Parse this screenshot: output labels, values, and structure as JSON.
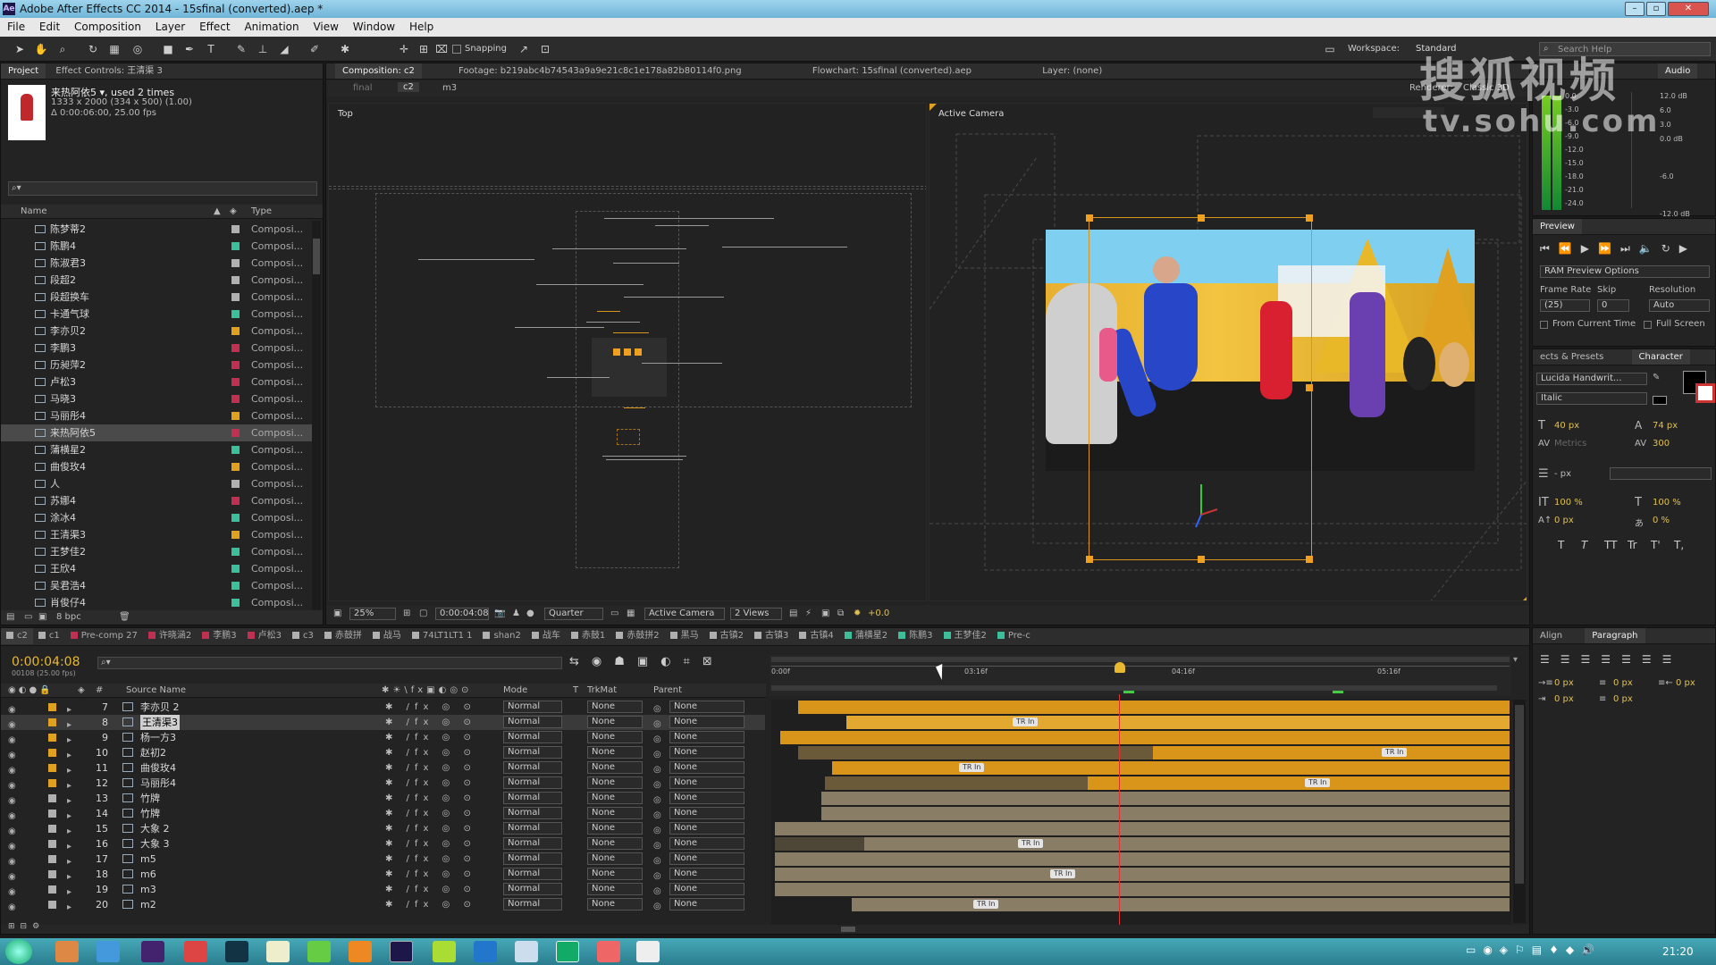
{
  "window": {
    "title": "Adobe After Effects CC 2014 - 15sfinal (converted).aep *"
  },
  "menu": [
    "File",
    "Edit",
    "Composition",
    "Layer",
    "Effect",
    "Animation",
    "View",
    "Window",
    "Help"
  ],
  "toolbar": {
    "snapping": "Snapping",
    "workspace_label": "Workspace:",
    "workspace_value": "Standard",
    "search": "Search Help"
  },
  "project": {
    "tabs": [
      "Project",
      "Effect Controls: 王清渠 3"
    ],
    "item_name": "来热阿依5",
    "used": ", used 2 times",
    "dims": "1333 x 2000  (334 x 500) (1.00)",
    "duration": "Δ 0:00:06:00, 25.00 fps",
    "search_placeholder": "",
    "col_name": "Name",
    "col_type": "Type",
    "items": [
      {
        "name": "陈梦蒂2",
        "type": "Composi...",
        "color": "#b0b0b0"
      },
      {
        "name": "陈鹏4",
        "type": "Composi...",
        "color": "#3cbf9a"
      },
      {
        "name": "陈淑君3",
        "type": "Composi...",
        "color": "#b0b0b0"
      },
      {
        "name": "段超2",
        "type": "Composi...",
        "color": "#b0b0b0"
      },
      {
        "name": "段超换车",
        "type": "Composi...",
        "color": "#b0b0b0"
      },
      {
        "name": "卡通气球",
        "type": "Composi...",
        "color": "#3cbf9a"
      },
      {
        "name": "李亦贝2",
        "type": "Composi...",
        "color": "#e0a020"
      },
      {
        "name": "李鹏3",
        "type": "Composi...",
        "color": "#c03050"
      },
      {
        "name": "历昶萍2",
        "type": "Composi...",
        "color": "#c03050"
      },
      {
        "name": "卢松3",
        "type": "Composi...",
        "color": "#c03050"
      },
      {
        "name": "马晓3",
        "type": "Composi...",
        "color": "#c03050"
      },
      {
        "name": "马丽彤4",
        "type": "Composi...",
        "color": "#e0a020"
      },
      {
        "name": "来热阿依5",
        "type": "Composi...",
        "color": "#c03050"
      },
      {
        "name": "蒲横星2",
        "type": "Composi...",
        "color": "#3cbf9a"
      },
      {
        "name": "曲俊玫4",
        "type": "Composi...",
        "color": "#e0a020"
      },
      {
        "name": "人",
        "type": "Composi...",
        "color": "#b0b0b0"
      },
      {
        "name": "苏娜4",
        "type": "Composi...",
        "color": "#c03050"
      },
      {
        "name": "涂冰4",
        "type": "Composi...",
        "color": "#3cbf9a"
      },
      {
        "name": "王清渠3",
        "type": "Composi...",
        "color": "#e0a020"
      },
      {
        "name": "王梦佳2",
        "type": "Composi...",
        "color": "#3cbf9a"
      },
      {
        "name": "王欣4",
        "type": "Composi...",
        "color": "#3cbf9a"
      },
      {
        "name": "吴君浩4",
        "type": "Composi...",
        "color": "#3cbf9a"
      },
      {
        "name": "肖俊仔4",
        "type": "Composi...",
        "color": "#3cbf9a"
      }
    ],
    "bpc": "8 bpc"
  },
  "viewer": {
    "tabs": [
      "Composition: c2",
      "Footage: b219abc4b74543a9a9e21c8c1e178a82b80114f0.png",
      "Flowchart: 15sfinal (converted).aep",
      "Layer: (none)"
    ],
    "crumbs": [
      "final",
      "c2",
      "m3"
    ],
    "renderer": "Renderer:",
    "renderer_value": "Classic 3D",
    "top_label": "Top",
    "active_label": "Active Camera",
    "zoom": "25%",
    "timecode": "0:00:04:08",
    "resolution": "Quarter",
    "camera": "Active Camera",
    "views": "2 Views",
    "exposure": "+0.0"
  },
  "audio": {
    "tab": "Audio",
    "left": [
      "0.0",
      "-3.0",
      "-6.0",
      "-9.0",
      "-12.0",
      "-15.0",
      "-18.0",
      "-21.0",
      "-24.0"
    ],
    "right": [
      "12.0 dB",
      "6.0",
      "3.0",
      "0.0 dB",
      "-6.0",
      "-12.0 dB"
    ]
  },
  "preview": {
    "tab": "Preview",
    "ram": "RAM Preview Options",
    "frame_rate": "Frame Rate",
    "skip": "Skip",
    "resolution": "Resolution",
    "fr_val": "(25)",
    "skip_val": "0",
    "res_val": "Auto",
    "from_current": "From Current Time",
    "full_screen": "Full Screen"
  },
  "character": {
    "tabs": [
      "ects & Presets",
      "Character"
    ],
    "font": "Lucida Handwrit...",
    "style": "Italic",
    "size": "40 px",
    "leading": "74 px",
    "kerning": "Metrics",
    "tracking": "300",
    "stroke": "- px",
    "vscale": "100 %",
    "hscale": "100 %",
    "baseline": "0 px",
    "tsume": "0 %",
    "fmt": [
      "T",
      "T",
      "TT",
      "Tr",
      "T'",
      "T,"
    ]
  },
  "paragraph": {
    "tabs": [
      "Align",
      "Paragraph"
    ],
    "indents": [
      "0 px",
      "0 px",
      "0 px",
      "0 px",
      "0 px"
    ]
  },
  "timeline": {
    "tabs": [
      {
        "name": "c2",
        "color": "#b0b0b0"
      },
      {
        "name": "c1",
        "color": "#b0b0b0"
      },
      {
        "name": "Pre-comp 27",
        "color": "#c03050"
      },
      {
        "name": "许晓涵2",
        "color": "#c03050"
      },
      {
        "name": "李鹏3",
        "color": "#c03050"
      },
      {
        "name": "卢松3",
        "color": "#c03050"
      },
      {
        "name": "c3",
        "color": "#b0b0b0"
      },
      {
        "name": "赤鼓拼",
        "color": "#b0b0b0"
      },
      {
        "name": "战马",
        "color": "#b0b0b0"
      },
      {
        "name": "74LT1LT1 1",
        "color": "#b0b0b0"
      },
      {
        "name": "shan2",
        "color": "#b0b0b0"
      },
      {
        "name": "战车",
        "color": "#b0b0b0"
      },
      {
        "name": "赤鼓1",
        "color": "#b0b0b0"
      },
      {
        "name": "赤鼓拼2",
        "color": "#b0b0b0"
      },
      {
        "name": "黑马",
        "color": "#b0b0b0"
      },
      {
        "name": "古镇2",
        "color": "#b0b0b0"
      },
      {
        "name": "古镇3",
        "color": "#b0b0b0"
      },
      {
        "name": "古镇4",
        "color": "#b0b0b0"
      },
      {
        "name": "蒲横星2",
        "color": "#3cbf9a"
      },
      {
        "name": "陈鹏3",
        "color": "#3cbf9a"
      },
      {
        "name": "王梦佳2",
        "color": "#3cbf9a"
      },
      {
        "name": "Pre-c",
        "color": "#3cbf9a"
      }
    ],
    "timecode": "0:00:04:08",
    "frames": "00108 (25.00 fps)",
    "headers": {
      "source": "Source Name",
      "mode": "Mode",
      "t": "T",
      "trkmat": "TrkMat",
      "parent": "Parent"
    },
    "ruler": [
      "0:00f",
      "03:16f",
      "04:16f",
      "05:16f"
    ],
    "layers": [
      {
        "num": "7",
        "name": "李亦贝 2",
        "color": "#e0a020",
        "mode": "Normal",
        "trk": "None",
        "parent": "None"
      },
      {
        "num": "8",
        "name": "王清渠3",
        "color": "#e0a020",
        "mode": "Normal",
        "trk": "None",
        "parent": "None"
      },
      {
        "num": "9",
        "name": "杨一方3",
        "color": "#e0a020",
        "mode": "Normal",
        "trk": "None",
        "parent": "None"
      },
      {
        "num": "10",
        "name": "赵初2",
        "color": "#e0a020",
        "mode": "Normal",
        "trk": "None",
        "parent": "None"
      },
      {
        "num": "11",
        "name": "曲俊玫4",
        "color": "#e0a020",
        "mode": "Normal",
        "trk": "None",
        "parent": "None"
      },
      {
        "num": "12",
        "name": "马丽彤4",
        "color": "#e0a020",
        "mode": "Normal",
        "trk": "None",
        "parent": "None"
      },
      {
        "num": "13",
        "name": "竹牌",
        "color": "#b0b0b0",
        "mode": "Normal",
        "trk": "None",
        "parent": "None"
      },
      {
        "num": "14",
        "name": "竹牌",
        "color": "#b0b0b0",
        "mode": "Normal",
        "trk": "None",
        "parent": "None"
      },
      {
        "num": "15",
        "name": "大象 2",
        "color": "#b0b0b0",
        "mode": "Normal",
        "trk": "None",
        "parent": "None"
      },
      {
        "num": "16",
        "name": "大象 3",
        "color": "#b0b0b0",
        "mode": "Normal",
        "trk": "None",
        "parent": "None"
      },
      {
        "num": "17",
        "name": "m5",
        "color": "#b0b0b0",
        "mode": "Normal",
        "trk": "None",
        "parent": "None"
      },
      {
        "num": "18",
        "name": "m6",
        "color": "#b0b0b0",
        "mode": "Normal",
        "trk": "None",
        "parent": "None"
      },
      {
        "num": "19",
        "name": "m3",
        "color": "#b0b0b0",
        "mode": "Normal",
        "trk": "None",
        "parent": "None"
      },
      {
        "num": "20",
        "name": "m2",
        "color": "#b0b0b0",
        "mode": "Normal",
        "trk": "None",
        "parent": "None"
      }
    ],
    "trans": "TR In"
  },
  "taskbar": {
    "time": "21:20"
  },
  "watermark": {
    "line1": "搜狐视频",
    "line2": "tv.sohu.com"
  }
}
